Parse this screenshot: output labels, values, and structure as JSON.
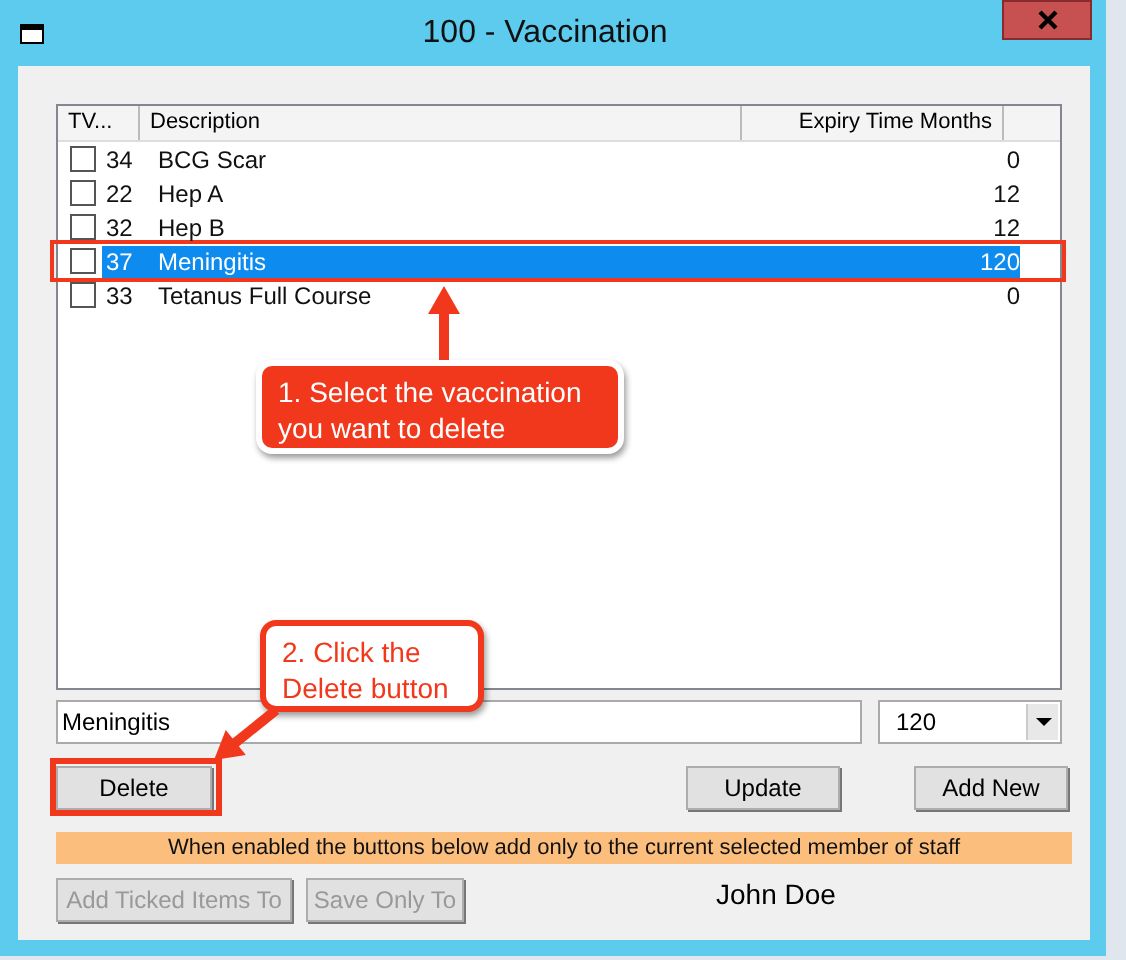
{
  "window": {
    "title": "100 - Vaccination"
  },
  "table": {
    "columns": [
      "TV...",
      "Description",
      "Expiry Time Months"
    ],
    "rows": [
      {
        "code": "34",
        "description": "BCG Scar",
        "expiry": "0",
        "checked": false,
        "selected": false
      },
      {
        "code": "22",
        "description": "Hep A",
        "expiry": "12",
        "checked": false,
        "selected": false
      },
      {
        "code": "32",
        "description": "Hep B",
        "expiry": "12",
        "checked": false,
        "selected": false
      },
      {
        "code": "37",
        "description": "Meningitis",
        "expiry": "120",
        "checked": false,
        "selected": true
      },
      {
        "code": "33",
        "description": "Tetanus Full Course",
        "expiry": "0",
        "checked": false,
        "selected": false
      }
    ]
  },
  "description_field": {
    "value": "Meningitis"
  },
  "expiry_dropdown": {
    "value": "120"
  },
  "buttons": [
    {
      "label": "Delete"
    },
    {
      "label": "Update"
    },
    {
      "label": "Add New"
    }
  ],
  "notice": "When enabled the buttons below add only to the current selected member of staff",
  "staff_buttons": [
    {
      "label": "Add Ticked Items To",
      "disabled": true
    },
    {
      "label": "Save Only To",
      "disabled": true
    }
  ],
  "staff_name": "John Doe",
  "annotations": [
    {
      "text": "1. Select the vaccination you want to delete"
    },
    {
      "text": "2. Click the Delete button"
    }
  ]
}
